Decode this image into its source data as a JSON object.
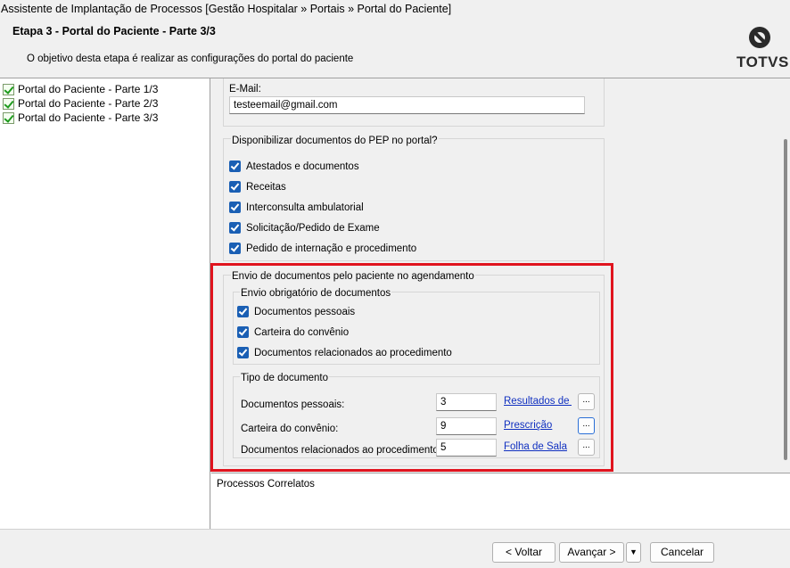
{
  "window": {
    "title": "Assistente de Implantação de Processos [Gestão Hospitalar » Portais » Portal do Paciente]"
  },
  "header": {
    "step_title": "Etapa 3 - Portal do Paciente - Parte 3/3",
    "step_description": "O objetivo desta etapa é realizar as configurações do portal do paciente",
    "logo_text": "TOTVS"
  },
  "steps": [
    {
      "label": "Portal do Paciente - Parte 1/3"
    },
    {
      "label": "Portal do Paciente - Parte 2/3"
    },
    {
      "label": "Portal do Paciente - Parte 3/3"
    }
  ],
  "email": {
    "label": "E-Mail:",
    "value": "testeemail@gmail.com"
  },
  "pep_group": {
    "title": "Disponibilizar documentos do PEP no portal?",
    "items": [
      {
        "label": "Atestados e documentos",
        "checked": true
      },
      {
        "label": "Receitas",
        "checked": true
      },
      {
        "label": "Interconsulta ambulatorial",
        "checked": true
      },
      {
        "label": "Solicitação/Pedido de Exame",
        "checked": true
      },
      {
        "label": "Pedido de internação e procedimento",
        "checked": true
      }
    ]
  },
  "envio_group": {
    "title": "Envio de documentos pelo paciente no agendamento",
    "obrigatorio": {
      "title": "Envio obrigatório de documentos",
      "items": [
        {
          "label": "Documentos pessoais",
          "checked": true
        },
        {
          "label": "Carteira do convênio",
          "checked": true
        },
        {
          "label": "Documentos relacionados ao procedimento",
          "checked": true
        }
      ]
    },
    "tipo": {
      "title": "Tipo de documento",
      "rows": [
        {
          "label": "Documentos pessoais:",
          "value": "3",
          "link": "Resultados de E",
          "button": "..."
        },
        {
          "label": "Carteira do convênio:",
          "value": "9",
          "link": "Prescrição",
          "button": "..."
        },
        {
          "label": "Documentos relacionados ao procedimento:",
          "value": "5",
          "link": "Folha de Sala",
          "button": "..."
        }
      ]
    }
  },
  "related": {
    "title": "Processos Correlatos"
  },
  "footer": {
    "back_label": "< Voltar",
    "next_label": "Avançar >",
    "dropdown_label": "▼",
    "cancel_label": "Cancelar"
  },
  "colors": {
    "highlight": "#e0141e",
    "checkbox": "#1a5fb4",
    "link": "#1030c0"
  }
}
